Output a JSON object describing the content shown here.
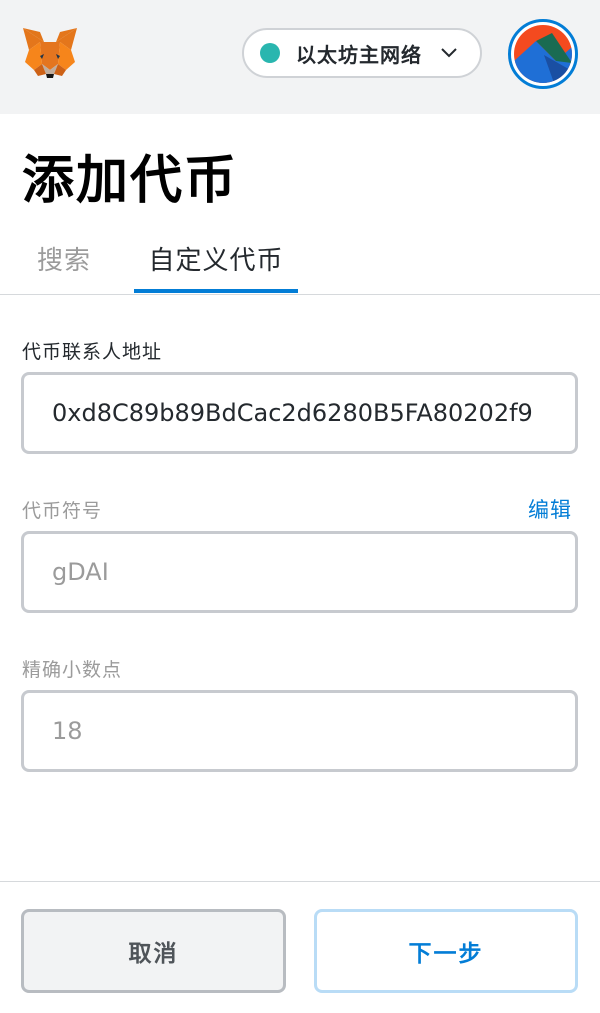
{
  "header": {
    "network": {
      "label": "以太坊主网络",
      "dot_color": "#29b6af"
    },
    "logo_icon": "metamask-fox-icon",
    "avatar_icon": "account-identicon"
  },
  "page": {
    "title": "添加代币"
  },
  "tabs": [
    {
      "label": "搜索",
      "active": false
    },
    {
      "label": "自定义代币",
      "active": true
    }
  ],
  "form": {
    "address": {
      "label": "代币联系人地址",
      "value": "0xd8C89b89BdCac2d6280B5FA80202f9"
    },
    "symbol": {
      "label": "代币符号",
      "value": "gDAI",
      "edit_label": "编辑"
    },
    "decimals": {
      "label": "精确小数点",
      "value": "18"
    }
  },
  "footer": {
    "cancel_label": "取消",
    "next_label": "下一步"
  },
  "colors": {
    "accent": "#037dd6",
    "header_bg": "#f2f3f4",
    "muted_text": "#9b9b9b"
  }
}
